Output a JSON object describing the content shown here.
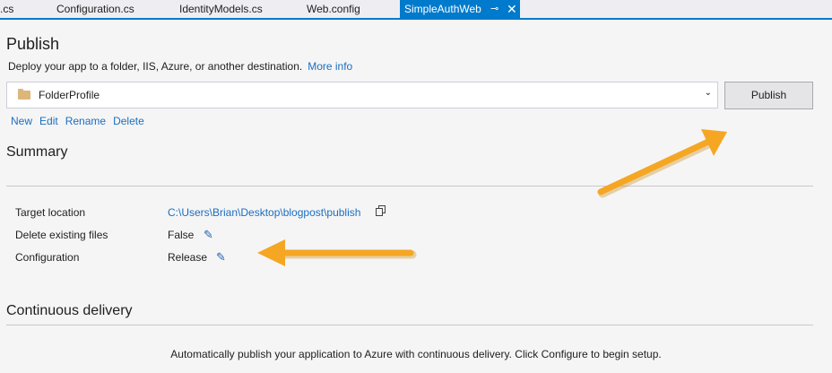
{
  "tabs": [
    {
      "label": ".cs"
    },
    {
      "label": "Configuration.cs"
    },
    {
      "label": "IdentityModels.cs"
    },
    {
      "label": "Web.config"
    },
    {
      "label": "SimpleAuthWeb",
      "active": true
    }
  ],
  "publish": {
    "title": "Publish",
    "subtitle": "Deploy your app to a folder, IIS, Azure, or another destination.",
    "more_info": "More info",
    "profile": "FolderProfile",
    "publish_button": "Publish",
    "actions": [
      "New",
      "Edit",
      "Rename",
      "Delete"
    ]
  },
  "summary": {
    "title": "Summary",
    "rows": [
      {
        "label": "Target location",
        "value": "C:\\Users\\Brian\\Desktop\\blogpost\\publish"
      },
      {
        "label": "Delete existing files",
        "value": "False"
      },
      {
        "label": "Configuration",
        "value": "Release"
      }
    ]
  },
  "continuous_delivery": {
    "title": "Continuous delivery",
    "text": "Automatically publish your application to Azure with continuous delivery. Click Configure to begin setup."
  },
  "colors": {
    "accent": "#007acc",
    "link": "#1a6fc2",
    "annotation_arrow": "#f5a623"
  },
  "icons": {
    "pin": "pin-icon",
    "close": "close-icon",
    "folder": "folder-icon",
    "dropdown": "chevron-down-icon",
    "copy": "copy-icon",
    "edit": "pencil-icon"
  }
}
